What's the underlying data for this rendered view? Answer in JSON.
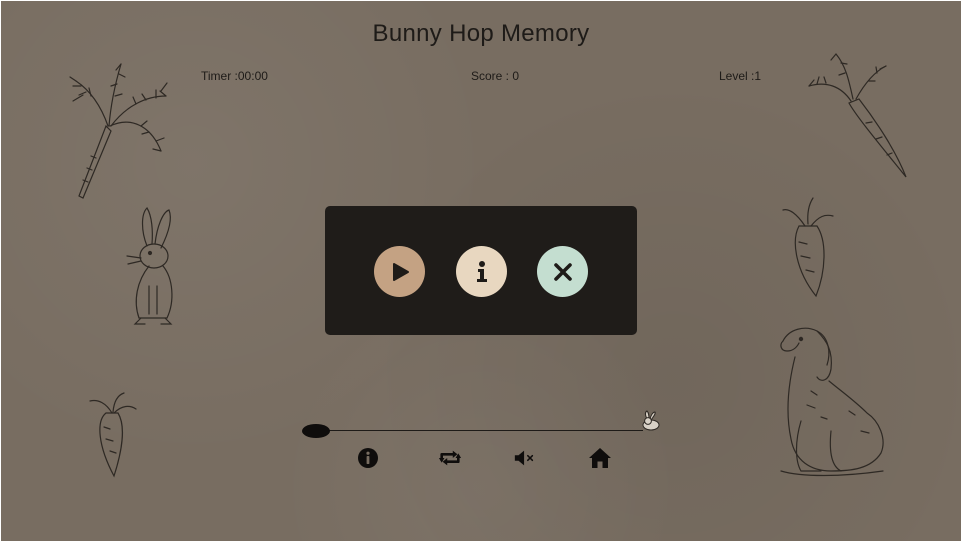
{
  "game": {
    "title": "Bunny Hop Memory",
    "timer_text": "Timer :00:00",
    "score_text": "Score : 0",
    "level_text": "Level :1"
  },
  "menu": {
    "buttons": [
      {
        "icon": "play-icon",
        "color": "#c4a283"
      },
      {
        "icon": "info-icon",
        "color": "#e8d7c0"
      },
      {
        "icon": "close-icon",
        "color": "#c4ded0"
      }
    ]
  },
  "progress": {
    "value": 0
  },
  "toolbar": {
    "icons": [
      "info-icon",
      "repeat-icon",
      "mute-icon",
      "home-icon"
    ]
  },
  "colors": {
    "background": "#786d61",
    "overlay": "#1f1c19",
    "text": "#1e1b18"
  }
}
